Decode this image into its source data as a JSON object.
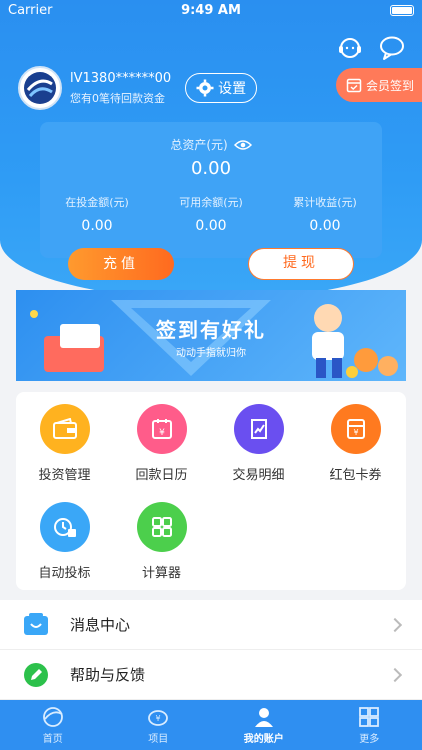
{
  "status_bar": {
    "carrier": "Carrier",
    "time": "9:49 AM"
  },
  "profile": {
    "username": "lV1380******00",
    "subtitle": "您有0笔待回款资金",
    "settings_label": "设置"
  },
  "checkin_label": "会员签到",
  "assets": {
    "title": "总资产(元)",
    "total": "0.00",
    "columns": [
      {
        "label": "在投金额(元)",
        "value": "0.00"
      },
      {
        "label": "可用余额(元)",
        "value": "0.00"
      },
      {
        "label": "累计收益(元)",
        "value": "0.00"
      }
    ]
  },
  "actions": {
    "recharge": "充值",
    "withdraw": "提现"
  },
  "banner": {
    "title": "签到有好礼",
    "subtitle": "动动手指就归你"
  },
  "grid": [
    {
      "label": "投资管理",
      "icon": "wallet-icon",
      "color": "#ffb21f"
    },
    {
      "label": "回款日历",
      "icon": "calendar-icon",
      "color": "#ff5c8a"
    },
    {
      "label": "交易明细",
      "icon": "chart-icon",
      "color": "#6a4ff0"
    },
    {
      "label": "红包卡券",
      "icon": "redpacket-icon",
      "color": "#ff7a1f"
    },
    {
      "label": "自动投标",
      "icon": "clock-icon",
      "color": "#3aa7f7"
    },
    {
      "label": "计算器",
      "icon": "calculator-icon",
      "color": "#4ccf4c"
    }
  ],
  "list": [
    {
      "label": "消息中心",
      "icon": "message-icon"
    },
    {
      "label": "帮助与反馈",
      "icon": "edit-icon"
    }
  ],
  "tabs": [
    {
      "label": "首页",
      "icon": "home-icon"
    },
    {
      "label": "项目",
      "icon": "piggy-bank-icon"
    },
    {
      "label": "我的账户",
      "icon": "user-icon",
      "active": true
    },
    {
      "label": "更多",
      "icon": "more-grid-icon"
    }
  ]
}
